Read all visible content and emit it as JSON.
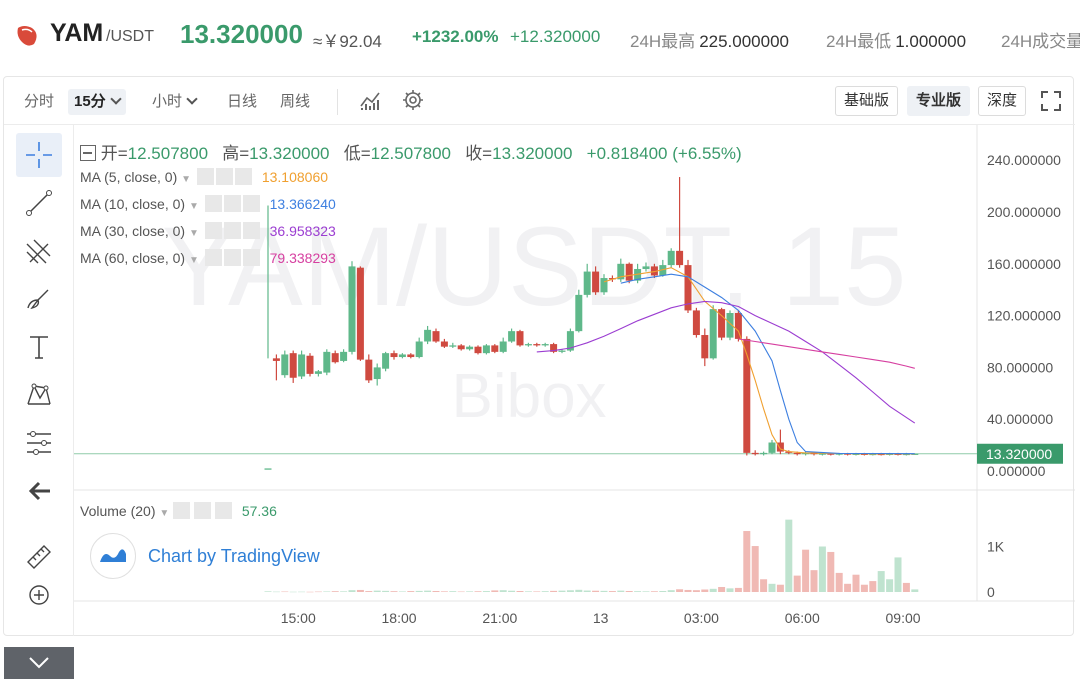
{
  "ticker": {
    "base": "YAM",
    "quote": "/USDT",
    "price": "13.320000",
    "cny": "≈￥92.04",
    "change_pct": "+1232.00%",
    "change_abs": "+12.320000",
    "high_label": "24H最高",
    "high_value": "225.000000",
    "low_label": "24H最低",
    "low_value": "1.000000",
    "vol_label": "24H成交量"
  },
  "toolbar": {
    "intervals": [
      "分时",
      "15分",
      "小时",
      "日线",
      "周线"
    ],
    "selected_interval": "15分",
    "views": [
      "基础版",
      "专业版",
      "深度"
    ],
    "active_view": "专业版"
  },
  "legend": {
    "ohlc_open_label": "开=",
    "ohlc_open": "12.507800",
    "ohlc_high_label": "高=",
    "ohlc_high": "13.320000",
    "ohlc_low_label": "低=",
    "ohlc_low": "12.507800",
    "ohlc_close_label": "收=",
    "ohlc_close": "13.320000",
    "ohlc_change": "+0.818400 (+6.55%)",
    "ma": [
      {
        "label": "MA (5, close, 0)",
        "value": "13.108060",
        "color": "#f0a030"
      },
      {
        "label": "MA (10, close, 0)",
        "value": "13.366240",
        "color": "#3d7fe0"
      },
      {
        "label": "MA (30, close, 0)",
        "value": "36.958323",
        "color": "#9b3dd1"
      },
      {
        "label": "MA (60, close, 0)",
        "value": "79.338293",
        "color": "#d63fa0"
      }
    ],
    "volume_label": "Volume (20)",
    "volume_value": "57.36"
  },
  "watermark": {
    "line1": "YAM/USDT, 15",
    "line2": "Bibox"
  },
  "branding": {
    "tradingview": "Chart by TradingView"
  },
  "colors": {
    "up": "#5fb88a",
    "down": "#cf4a40",
    "up_text": "#3a9a6b",
    "accent": "#2f7fd6"
  },
  "chart_data": {
    "type": "candlestick",
    "price_axis": {
      "ticks": [
        "240.000000",
        "200.000000",
        "160.000000",
        "120.000000",
        "80.000000",
        "40.000000",
        "0.000000"
      ],
      "values": [
        240,
        200,
        160,
        120,
        80,
        40,
        0
      ],
      "last_price_label": "13.320000",
      "last_price": 13.32
    },
    "volume_axis": {
      "ticks": [
        "1K",
        "0"
      ],
      "values": [
        1000,
        0
      ]
    },
    "time_axis": {
      "labels": [
        "15:00",
        "18:00",
        "21:00",
        "13",
        "03:00",
        "06:00",
        "09:00"
      ],
      "hours": [
        15,
        18,
        21,
        24,
        27,
        30,
        33
      ]
    },
    "candles": [
      [
        14.1,
        1,
        2,
        205,
        87
      ],
      [
        14.35,
        87,
        85,
        90,
        70
      ],
      [
        14.6,
        74,
        90,
        93,
        72
      ],
      [
        14.85,
        91,
        72,
        93,
        68
      ],
      [
        15.1,
        73,
        90,
        93,
        71
      ],
      [
        15.35,
        89,
        75,
        91,
        73
      ],
      [
        15.6,
        75,
        77,
        78,
        73
      ],
      [
        15.85,
        76,
        92,
        94,
        74
      ],
      [
        16.1,
        91,
        84,
        93,
        83
      ],
      [
        16.35,
        85,
        92,
        94,
        84
      ],
      [
        16.6,
        92,
        158,
        162,
        90
      ],
      [
        16.85,
        157,
        86,
        158,
        85
      ],
      [
        17.1,
        86,
        70,
        90,
        68
      ],
      [
        17.35,
        71,
        80,
        83,
        66
      ],
      [
        17.6,
        79,
        91,
        92,
        77
      ],
      [
        17.85,
        91,
        88,
        93,
        86
      ],
      [
        18.1,
        88,
        90,
        91,
        87
      ],
      [
        18.35,
        90,
        88,
        91,
        87
      ],
      [
        18.6,
        88,
        100,
        103,
        87
      ],
      [
        18.85,
        100,
        109,
        112,
        98
      ],
      [
        19.1,
        108,
        100,
        110,
        99
      ],
      [
        19.35,
        100,
        96,
        102,
        95
      ],
      [
        19.6,
        96,
        97,
        99,
        95
      ],
      [
        19.85,
        97,
        94,
        98,
        93
      ],
      [
        20.1,
        94,
        96,
        97,
        93
      ],
      [
        20.35,
        96,
        91,
        97,
        90
      ],
      [
        20.6,
        91,
        97,
        98,
        90
      ],
      [
        20.85,
        97,
        92,
        98,
        91
      ],
      [
        21.1,
        92,
        100,
        103,
        91
      ],
      [
        21.35,
        100,
        108,
        110,
        99
      ],
      [
        21.6,
        108,
        97,
        109,
        96
      ],
      [
        21.85,
        97,
        98,
        99,
        96
      ],
      [
        22.1,
        98,
        97,
        99,
        96
      ],
      [
        22.35,
        97,
        98,
        99,
        96
      ],
      [
        22.6,
        98,
        92,
        99,
        91
      ],
      [
        22.85,
        92,
        93,
        94,
        91
      ],
      [
        23.1,
        93,
        108,
        110,
        92
      ],
      [
        23.35,
        108,
        136,
        140,
        107
      ],
      [
        23.6,
        136,
        154,
        160,
        134
      ],
      [
        23.85,
        154,
        138,
        158,
        136
      ],
      [
        24.1,
        138,
        149,
        152,
        136
      ],
      [
        24.35,
        149,
        148,
        151,
        146
      ],
      [
        24.6,
        148,
        160,
        164,
        146
      ],
      [
        24.85,
        160,
        147,
        161,
        145
      ],
      [
        25.1,
        147,
        156,
        160,
        145
      ],
      [
        25.35,
        156,
        158,
        161,
        154
      ],
      [
        25.6,
        158,
        151,
        160,
        149
      ],
      [
        25.85,
        151,
        159,
        163,
        150
      ],
      [
        26.1,
        159,
        170,
        172,
        157
      ],
      [
        26.35,
        170,
        159,
        227,
        157
      ],
      [
        26.6,
        159,
        124,
        163,
        122
      ],
      [
        26.85,
        124,
        105,
        126,
        103
      ],
      [
        27.1,
        105,
        87,
        110,
        81
      ],
      [
        27.35,
        87,
        125,
        128,
        86
      ],
      [
        27.6,
        125,
        103,
        126,
        101
      ],
      [
        27.85,
        103,
        122,
        124,
        101
      ],
      [
        28.1,
        122,
        102,
        124,
        100
      ],
      [
        28.35,
        102,
        14,
        104,
        12
      ],
      [
        28.6,
        14,
        13,
        16,
        12
      ],
      [
        28.85,
        13,
        14,
        15,
        12
      ],
      [
        29.1,
        14,
        22,
        24,
        13
      ],
      [
        29.35,
        22,
        15,
        32,
        13
      ],
      [
        29.6,
        15,
        14,
        16,
        13
      ],
      [
        29.85,
        14,
        13,
        15,
        12
      ],
      [
        30.1,
        13,
        14,
        15,
        12
      ],
      [
        30.35,
        14,
        13,
        15,
        12
      ],
      [
        30.6,
        13,
        13.5,
        14,
        12
      ],
      [
        30.85,
        13.5,
        13,
        14,
        12
      ],
      [
        31.1,
        13,
        13.5,
        14,
        12
      ],
      [
        31.35,
        13.5,
        13,
        14,
        12
      ],
      [
        31.6,
        13,
        13.3,
        14,
        12
      ],
      [
        31.85,
        13.3,
        12.9,
        14,
        12
      ],
      [
        32.1,
        12.9,
        13.2,
        14,
        12
      ],
      [
        32.35,
        13.2,
        12.8,
        14,
        12
      ],
      [
        32.6,
        12.8,
        13.3,
        14,
        12
      ],
      [
        32.85,
        13.3,
        12.7,
        14,
        12
      ],
      [
        33.1,
        12.7,
        13.2,
        14,
        12
      ],
      [
        33.35,
        12.5,
        13.32,
        13.32,
        12.5
      ]
    ],
    "volumes": [
      [
        14.1,
        15,
        1
      ],
      [
        14.35,
        8,
        1
      ],
      [
        14.6,
        10,
        0
      ],
      [
        14.85,
        6,
        1
      ],
      [
        15.1,
        7,
        1
      ],
      [
        15.35,
        5,
        0
      ],
      [
        15.6,
        9,
        0
      ],
      [
        15.85,
        12,
        1
      ],
      [
        16.1,
        18,
        0
      ],
      [
        16.35,
        14,
        1
      ],
      [
        16.6,
        40,
        1
      ],
      [
        16.85,
        45,
        0
      ],
      [
        17.1,
        20,
        0
      ],
      [
        17.35,
        30,
        1
      ],
      [
        17.6,
        25,
        1
      ],
      [
        17.85,
        18,
        0
      ],
      [
        18.1,
        12,
        1
      ],
      [
        18.35,
        20,
        0
      ],
      [
        18.6,
        24,
        1
      ],
      [
        18.85,
        30,
        1
      ],
      [
        19.1,
        22,
        0
      ],
      [
        19.35,
        14,
        0
      ],
      [
        19.6,
        18,
        1
      ],
      [
        19.85,
        10,
        0
      ],
      [
        20.1,
        14,
        1
      ],
      [
        20.35,
        16,
        0
      ],
      [
        20.6,
        20,
        1
      ],
      [
        20.85,
        35,
        0
      ],
      [
        21.1,
        40,
        1
      ],
      [
        21.35,
        28,
        1
      ],
      [
        21.6,
        22,
        0
      ],
      [
        21.85,
        14,
        1
      ],
      [
        22.1,
        12,
        0
      ],
      [
        22.35,
        18,
        1
      ],
      [
        22.6,
        25,
        0
      ],
      [
        22.85,
        30,
        1
      ],
      [
        23.1,
        38,
        1
      ],
      [
        23.35,
        48,
        1
      ],
      [
        23.6,
        32,
        1
      ],
      [
        23.85,
        28,
        0
      ],
      [
        24.1,
        25,
        1
      ],
      [
        24.35,
        20,
        0
      ],
      [
        24.6,
        30,
        1
      ],
      [
        24.85,
        22,
        0
      ],
      [
        25.1,
        18,
        1
      ],
      [
        25.35,
        14,
        1
      ],
      [
        25.6,
        16,
        0
      ],
      [
        25.85,
        22,
        1
      ],
      [
        26.1,
        40,
        1
      ],
      [
        26.35,
        60,
        0
      ],
      [
        26.6,
        45,
        0
      ],
      [
        26.85,
        40,
        0
      ],
      [
        27.1,
        55,
        0
      ],
      [
        27.35,
        70,
        1
      ],
      [
        27.6,
        110,
        0
      ],
      [
        27.85,
        80,
        1
      ],
      [
        28.1,
        90,
        0
      ],
      [
        28.35,
        1340,
        0
      ],
      [
        28.6,
        1010,
        0
      ],
      [
        28.85,
        280,
        0
      ],
      [
        29.1,
        180,
        1
      ],
      [
        29.35,
        160,
        0
      ],
      [
        29.6,
        1590,
        1
      ],
      [
        29.85,
        360,
        0
      ],
      [
        30.1,
        930,
        0
      ],
      [
        30.35,
        480,
        0
      ],
      [
        30.6,
        1000,
        1
      ],
      [
        30.85,
        880,
        0
      ],
      [
        31.1,
        420,
        0
      ],
      [
        31.35,
        180,
        0
      ],
      [
        31.6,
        380,
        0
      ],
      [
        31.85,
        160,
        0
      ],
      [
        32.1,
        240,
        0
      ],
      [
        32.35,
        460,
        1
      ],
      [
        32.6,
        280,
        1
      ],
      [
        32.85,
        760,
        1
      ],
      [
        33.1,
        200,
        0
      ],
      [
        33.35,
        57,
        1
      ]
    ],
    "ma5": [
      [
        24.1,
        146
      ],
      [
        24.6,
        150
      ],
      [
        25.1,
        152
      ],
      [
        25.6,
        154
      ],
      [
        26.1,
        157
      ],
      [
        26.6,
        150
      ],
      [
        27.1,
        131
      ],
      [
        27.6,
        120
      ],
      [
        28.1,
        108
      ],
      [
        28.35,
        90
      ],
      [
        28.6,
        70
      ],
      [
        28.85,
        48
      ],
      [
        29.1,
        28
      ],
      [
        29.35,
        17
      ],
      [
        29.6,
        15
      ],
      [
        30.1,
        14
      ],
      [
        31.1,
        13.5
      ],
      [
        32.1,
        13.2
      ],
      [
        33.35,
        13.1
      ]
    ],
    "ma10": [
      [
        24.6,
        145
      ],
      [
        25.1,
        148
      ],
      [
        25.6,
        150
      ],
      [
        26.1,
        152
      ],
      [
        26.6,
        150
      ],
      [
        27.1,
        142
      ],
      [
        27.6,
        134
      ],
      [
        28.1,
        124
      ],
      [
        28.6,
        108
      ],
      [
        29.1,
        85
      ],
      [
        29.35,
        62
      ],
      [
        29.6,
        40
      ],
      [
        29.85,
        22
      ],
      [
        30.1,
        15
      ],
      [
        31.1,
        13.6
      ],
      [
        33.35,
        13.37
      ]
    ],
    "ma30": [
      [
        22.1,
        92
      ],
      [
        22.6,
        93
      ],
      [
        23.1,
        95
      ],
      [
        23.6,
        99
      ],
      [
        24.1,
        104
      ],
      [
        24.6,
        110
      ],
      [
        25.1,
        116
      ],
      [
        25.6,
        121
      ],
      [
        26.1,
        126
      ],
      [
        26.6,
        129
      ],
      [
        27.1,
        131
      ],
      [
        27.6,
        130
      ],
      [
        28.1,
        127
      ],
      [
        28.6,
        120
      ],
      [
        29.1,
        114
      ],
      [
        29.6,
        108
      ],
      [
        30.1,
        100
      ],
      [
        30.6,
        92
      ],
      [
        31.1,
        82
      ],
      [
        31.6,
        72
      ],
      [
        32.1,
        61
      ],
      [
        32.6,
        50
      ],
      [
        33.35,
        37
      ]
    ],
    "ma60": [
      [
        28.1,
        102
      ],
      [
        28.6,
        100
      ],
      [
        29.1,
        98
      ],
      [
        29.6,
        96
      ],
      [
        30.1,
        94
      ],
      [
        30.6,
        92
      ],
      [
        31.1,
        90
      ],
      [
        31.6,
        88
      ],
      [
        32.1,
        86
      ],
      [
        32.6,
        84
      ],
      [
        33.1,
        81
      ],
      [
        33.35,
        79.3
      ]
    ]
  }
}
